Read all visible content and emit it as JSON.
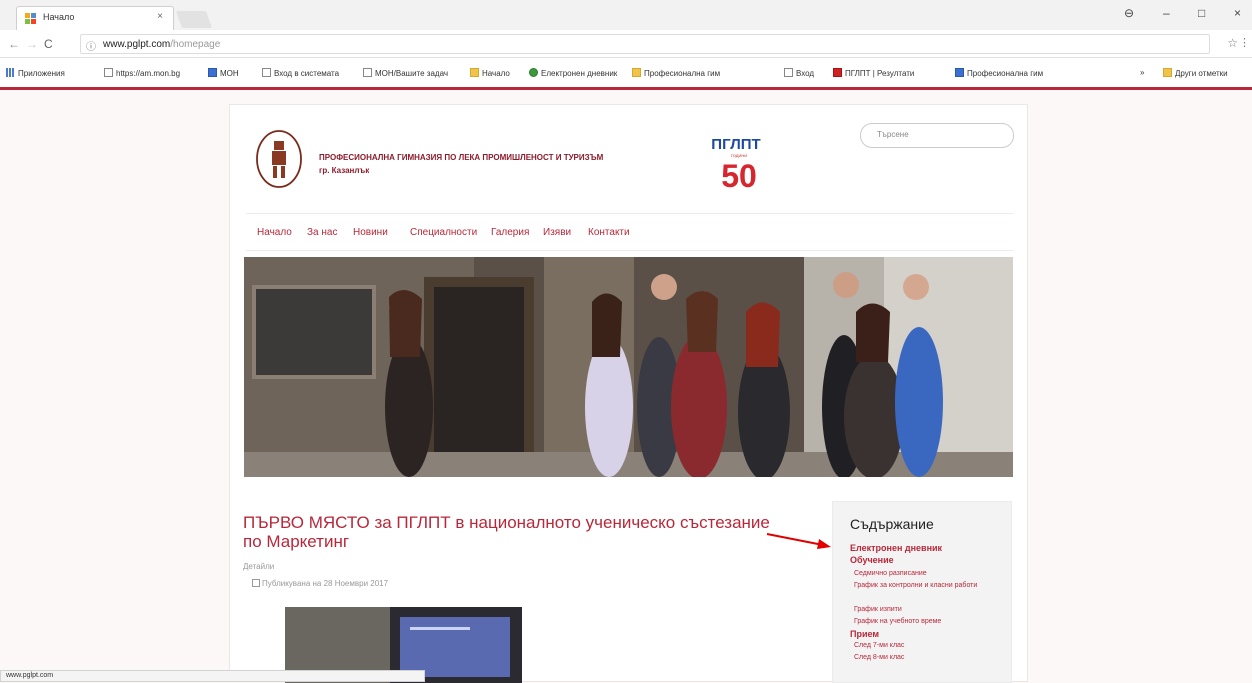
{
  "browser": {
    "tab_title": "Начало",
    "tab_close": "×",
    "nav": {
      "back": "←",
      "forward": "→",
      "reload": "C"
    },
    "url_host": "www.pglpt.com",
    "url_path": "/homepage",
    "info_icon": "ⓘ",
    "star": "☆",
    "more": "⋮",
    "window_controls": {
      "account": "⊖",
      "minimize": "–",
      "maximize": "□",
      "close": "×"
    },
    "bookmarks": [
      {
        "label": "Приложения",
        "icon": "grid"
      },
      {
        "label": "https://am.mon.bg",
        "icon": "page"
      },
      {
        "label": "МОН",
        "icon": "blue"
      },
      {
        "label": "Вход в системата",
        "icon": "page"
      },
      {
        "label": "МОН/Вашите задач",
        "icon": "page"
      },
      {
        "label": "Начало",
        "icon": "folder"
      },
      {
        "label": "Електронен дневник",
        "icon": "green"
      },
      {
        "label": "Професионална гим",
        "icon": "folder"
      },
      {
        "label": "Вход",
        "icon": "page"
      },
      {
        "label": "ПГЛПТ | Резултати",
        "icon": "red"
      },
      {
        "label": "Професионална гим",
        "icon": "blue"
      },
      {
        "label": "»",
        "icon": "none"
      },
      {
        "label": "Други отметки",
        "icon": "folder"
      }
    ]
  },
  "site": {
    "school_name": "ПРОФЕСИОНАЛНА ГИМНАЗИЯ ПО ЛЕКА ПРОМИШЛЕНОСТ И ТУРИЗЪМ",
    "school_city": "гр. Казанлък",
    "anniv_abbr": "ПГЛПТ",
    "anniv_small": "ГОДИНИ",
    "anniv_number": "50",
    "search_placeholder": "Търсене",
    "menu": [
      "Начало",
      "За нас",
      "Новини",
      "Специалности",
      "Галерия",
      "Изяви",
      "Контакти"
    ]
  },
  "article": {
    "title": "ПЪРВО МЯСТО за ПГЛПТ в националното ученическо състезание по Маркетинг",
    "details": "Детайли",
    "published": "Публикувана на 28 Ноември 2017"
  },
  "sidebar": {
    "heading": "Съдържание",
    "link1": "Електронен дневник",
    "link2": "Обучение",
    "sub": [
      "Седмично разписание",
      "График за контролни и класни работи",
      "График изпити",
      "График на учебното време"
    ],
    "link3": "Прием",
    "sub2": [
      "След 7-ми клас",
      "След 8-ми клас"
    ]
  },
  "status_url": "www.pglpt.com",
  "colors": {
    "accent": "#b8283a",
    "page_bg": "#fdf8f8"
  }
}
